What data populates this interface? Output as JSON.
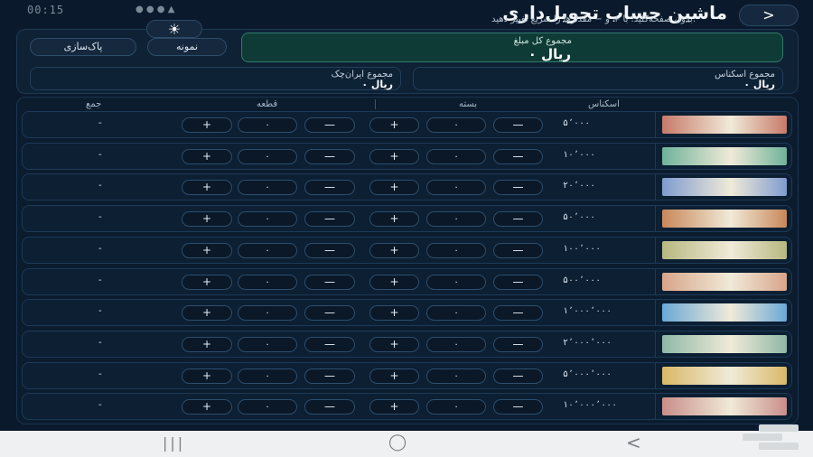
{
  "status": {
    "time": "00:15",
    "icons": "● ● ● ▲"
  },
  "header": {
    "back_icon": "chevron-right",
    "back_label": ">",
    "title": "ماشین حساب تحویل‌داری",
    "subtitle": "بدون صفحه‌کلید؛ با + و − مقدارها را سریع تغییر دهید.",
    "theme_icon": "sun-icon",
    "theme_label": "☀"
  },
  "controls": {
    "sample_label": "نمونه",
    "clear_label": "پاک‌سازی"
  },
  "totals": {
    "grand_label": "مجموع کل مبلغ",
    "grand_value": "۰ ریال",
    "iranchek_label": "مجموع ایران‌چک",
    "iranchek_value": "۰ ریال",
    "banknote_label": "مجموع اسکناس",
    "banknote_value": "۰ ریال"
  },
  "table": {
    "headers": {
      "banknote": "اسکناس",
      "bundle": "بسته",
      "piece": "قطعه",
      "sum": "جمع"
    },
    "rows": [
      {
        "denom": "۵٬۰۰۰",
        "bundle": "۰",
        "piece": "۰",
        "sum": "-",
        "color": "#c77a6a"
      },
      {
        "denom": "۱۰٬۰۰۰",
        "bundle": "۰",
        "piece": "۰",
        "sum": "-",
        "color": "#6fb39a"
      },
      {
        "denom": "۲۰٬۰۰۰",
        "bundle": "۰",
        "piece": "۰",
        "sum": "-",
        "color": "#7f9ccf"
      },
      {
        "denom": "۵۰٬۰۰۰",
        "bundle": "۰",
        "piece": "۰",
        "sum": "-",
        "color": "#c8885a"
      },
      {
        "denom": "۱۰۰٬۰۰۰",
        "bundle": "۰",
        "piece": "۰",
        "sum": "-",
        "color": "#b7b880"
      },
      {
        "denom": "۵۰۰٬۰۰۰",
        "bundle": "۰",
        "piece": "۰",
        "sum": "-",
        "color": "#d8a58a"
      },
      {
        "denom": "۱٬۰۰۰٬۰۰۰",
        "bundle": "۰",
        "piece": "۰",
        "sum": "-",
        "color": "#6aa9d6"
      },
      {
        "denom": "۲٬۰۰۰٬۰۰۰",
        "bundle": "۰",
        "piece": "۰",
        "sum": "-",
        "color": "#8fb8a7"
      },
      {
        "denom": "۵٬۰۰۰٬۰۰۰",
        "bundle": "۰",
        "piece": "۰",
        "sum": "-",
        "color": "#d9b968"
      },
      {
        "denom": "۱۰٬۰۰۰٬۰۰۰",
        "bundle": "۰",
        "piece": "۰",
        "sum": "-",
        "color": "#c98e8a"
      }
    ],
    "minus_label": "—",
    "plus_label": "+"
  },
  "navbar": {
    "recents_label": "|||",
    "home_label": "◯",
    "back_label": "<"
  },
  "colors": {
    "background": "#0a1a2c",
    "accent_green": "#0f3b36",
    "border": "#1d3a57"
  }
}
